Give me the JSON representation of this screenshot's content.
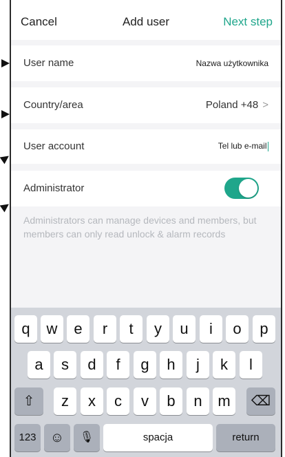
{
  "header": {
    "cancel": "Cancel",
    "title": "Add user",
    "next": "Next step"
  },
  "rows": {
    "user_name": {
      "label": "User name",
      "value": "Nazwa użytkownika"
    },
    "country": {
      "label": "Country/area",
      "value": "Poland +48",
      "chevron": ">"
    },
    "account": {
      "label": "User account",
      "value": "Tel lub e-mail"
    },
    "admin": {
      "label": "Administrator",
      "toggle_on": true
    }
  },
  "description": "Administrators can manage devices and members, but members can only read unlock & alarm records",
  "keyboard": {
    "row1": [
      "q",
      "w",
      "e",
      "r",
      "t",
      "y",
      "u",
      "i",
      "o",
      "p"
    ],
    "row2": [
      "a",
      "s",
      "d",
      "f",
      "g",
      "h",
      "j",
      "k",
      "l"
    ],
    "row3": [
      "z",
      "x",
      "c",
      "v",
      "b",
      "n",
      "m"
    ],
    "shift": "⇧",
    "backspace": "⌫",
    "numbers": "123",
    "emoji": "☺",
    "mic": "🎙",
    "space": "spacja",
    "return": "return"
  },
  "colors": {
    "accent": "#1fa68b",
    "background": "#f4f4f6",
    "keyboard": "#d2d5db"
  }
}
